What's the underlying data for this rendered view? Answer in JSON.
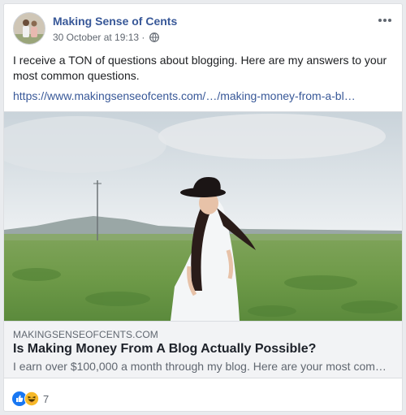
{
  "post": {
    "page_name": "Making Sense of Cents",
    "timestamp": "30 October at 19:13",
    "separator": "·",
    "privacy_icon": "globe-icon",
    "more_icon": "more-options-icon",
    "text": "I receive a TON of questions about blogging. Here are my answers to your most common questions.",
    "link": "https://www.makingsenseofcents.com/…/making-money-from-a-bl…"
  },
  "preview": {
    "domain": "MAKINGSENSEOFCENTS.COM",
    "title": "Is Making Money From A Blog Actually Possible?",
    "description": "I earn over $100,000 a month through my blog. Here are your most comm…"
  },
  "reactions": {
    "icons": [
      "like-icon",
      "haha-icon"
    ],
    "count": "7"
  },
  "colors": {
    "link": "#385898",
    "like": "#1877f2",
    "haha": "#f7b928"
  }
}
